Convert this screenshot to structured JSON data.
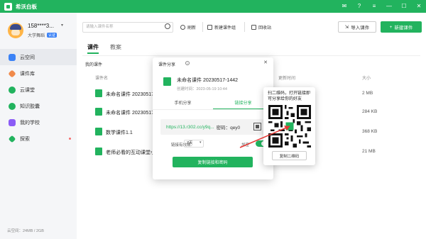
{
  "app": {
    "title": "希沃白板",
    "brand_color": "#22b35e"
  },
  "user": {
    "name": "158****3...",
    "org": "大学舞蹈",
    "badge": "认证"
  },
  "sidebar": {
    "items": [
      {
        "label": "云空间",
        "icon": "cloud-icon",
        "color": "#3b82f6",
        "active": true
      },
      {
        "label": "课件库",
        "icon": "gem-icon",
        "color": "#f08a4b"
      },
      {
        "label": "云课堂",
        "icon": "classroom-icon",
        "color": "#22b35e"
      },
      {
        "label": "知识胶囊",
        "icon": "capsule-icon",
        "color": "#22b35e"
      },
      {
        "label": "我的学校",
        "icon": "school-icon",
        "color": "#8b5cf6"
      },
      {
        "label": "探索",
        "icon": "rocket-icon",
        "color": "#22b35e",
        "dot": true
      }
    ],
    "storage": "云空间：24MB / 2GB"
  },
  "toolbar": {
    "search_placeholder": "请输入课件名称",
    "refresh": "刷新",
    "new_group": "新建课件组",
    "recycle": "回收站",
    "import": "导入课件",
    "new": "新建课件"
  },
  "tabs": [
    {
      "label": "课件",
      "active": true
    },
    {
      "label": "教案"
    }
  ],
  "section_title": "我的课件",
  "columns": {
    "name": "课件名",
    "updated": "更新时间",
    "size": "大小"
  },
  "rows": [
    {
      "name": "未命名课件 20230517",
      "size": "2 MB"
    },
    {
      "name": "未命名课件 20230517",
      "size": "284 KB"
    },
    {
      "name": "数学课件1.1",
      "size": "368 KB"
    },
    {
      "name": "老师必看的互动课堂小",
      "size": "21 MB"
    }
  ],
  "modal": {
    "title": "课件分享",
    "file_name": "未命名课件 20230517-1442",
    "file_date": "创建时间：2023-05-19 10:44",
    "tabs": [
      {
        "label": "手机分享"
      },
      {
        "label": "链接分享",
        "active": true
      }
    ],
    "link_url": "https://13.r302.cc/y9q...",
    "link_code": "密码：qey0",
    "expiry_label": "链接有效期：",
    "expiry_value": "7天",
    "encrypt_label": "加密",
    "copy_button": "复制链接和密码"
  },
  "qr_popup": {
    "text": "扫二维码，打开链接即可分享给你的好友",
    "copy_button": "复制二维码"
  }
}
